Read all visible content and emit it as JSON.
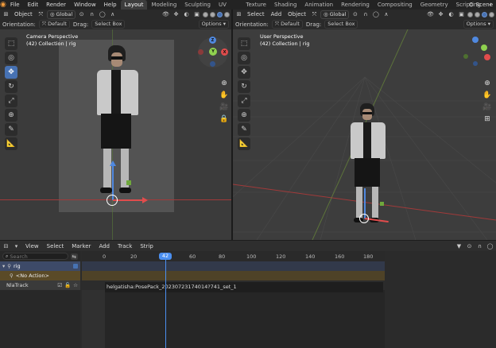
{
  "topbar": {
    "menus": [
      "File",
      "Edit",
      "Render",
      "Window",
      "Help"
    ],
    "workspaces": [
      "Layout",
      "Modeling",
      "Sculpting",
      "UV Editing",
      "Texture Paint",
      "Shading",
      "Animation",
      "Rendering",
      "Compositing",
      "Geometry Nodes",
      "Scripting"
    ],
    "active_workspace": "Layout",
    "add_tab": "+",
    "scene_label": "Scene"
  },
  "left_viewport": {
    "header": {
      "menus": [
        "Select",
        "Add",
        "Object"
      ],
      "first_menu": "Object",
      "transform": "Global"
    },
    "header2": {
      "orientation_label": "Orientation:",
      "orientation_value": "Default",
      "drag_label": "Drag:",
      "drag_value": "Select Box",
      "options": "Options"
    },
    "title": "Camera Perspective",
    "subtitle": "(42) Collection | rig"
  },
  "right_viewport": {
    "header": {
      "menus": [
        "Select",
        "Add",
        "Object"
      ],
      "transform": "Global"
    },
    "header2": {
      "orientation_label": "Orientation:",
      "orientation_value": "Default",
      "drag_label": "Drag:",
      "drag_value": "Select Box",
      "options": "Options"
    },
    "title": "User Perspective",
    "subtitle": "(42) Collection | rig"
  },
  "gizmo": {
    "z": "Z",
    "y": "Y",
    "x": "X"
  },
  "timeline": {
    "menus": [
      "View",
      "Select",
      "Marker",
      "Add",
      "Track",
      "Strip"
    ],
    "search_placeholder": "Search",
    "channels": {
      "rig": "rig",
      "no_action": "<No Action>",
      "nla_track": "NlaTrack"
    },
    "ruler": [
      "0",
      "20",
      "40",
      "60",
      "80",
      "100",
      "120",
      "140",
      "160",
      "180"
    ],
    "current_frame": "42",
    "strip_label": "helgatisha:PosePack_20230723174014?741_set_1"
  },
  "colors": {
    "accent": "#4772b3",
    "x_axis": "#e14c4c",
    "y_axis": "#8fd14f",
    "z_axis": "#5089e0",
    "playhead": "#4b8ff0"
  }
}
